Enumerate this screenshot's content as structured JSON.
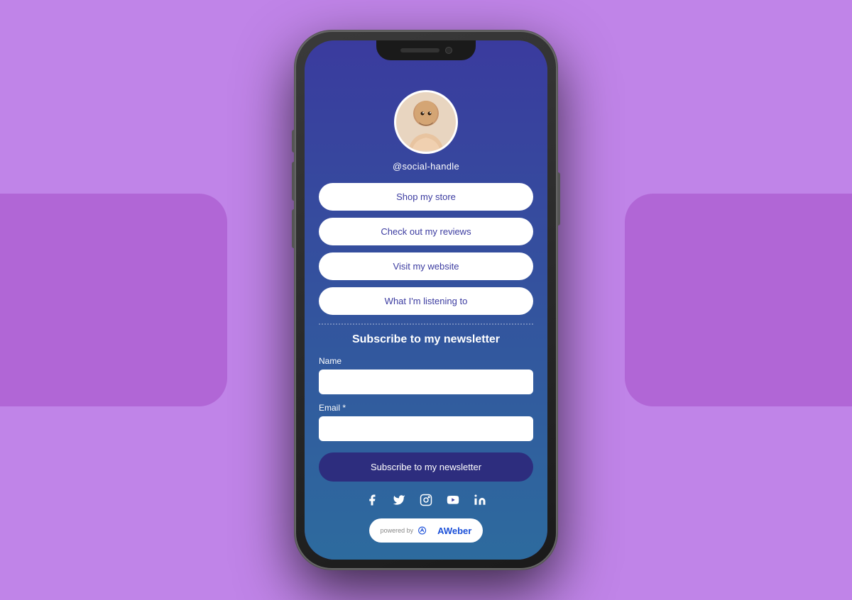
{
  "background": {
    "color": "#c084e8"
  },
  "phone": {
    "screen_bg_top": "#3a3b9e",
    "screen_bg_bottom": "#2d6b9e"
  },
  "profile": {
    "handle": "@social-handle"
  },
  "links": [
    {
      "id": "shop-store",
      "label": "Shop my store"
    },
    {
      "id": "check-reviews",
      "label": "Check out my reviews"
    },
    {
      "id": "visit-website",
      "label": "Visit my website"
    },
    {
      "id": "listening-to",
      "label": "What I'm listening to"
    }
  ],
  "newsletter": {
    "title": "Subscribe to my newsletter",
    "name_label": "Name",
    "email_label": "Email *",
    "name_placeholder": "",
    "email_placeholder": "",
    "button_label": "Subscribe to my newsletter"
  },
  "social": {
    "icons": [
      {
        "name": "facebook-icon",
        "symbol": "f"
      },
      {
        "name": "twitter-icon",
        "symbol": "t"
      },
      {
        "name": "instagram-icon",
        "symbol": "i"
      },
      {
        "name": "youtube-icon",
        "symbol": "y"
      },
      {
        "name": "linkedin-icon",
        "symbol": "in"
      }
    ]
  },
  "aweber": {
    "powered_by": "powered by",
    "brand": "AWeber"
  }
}
